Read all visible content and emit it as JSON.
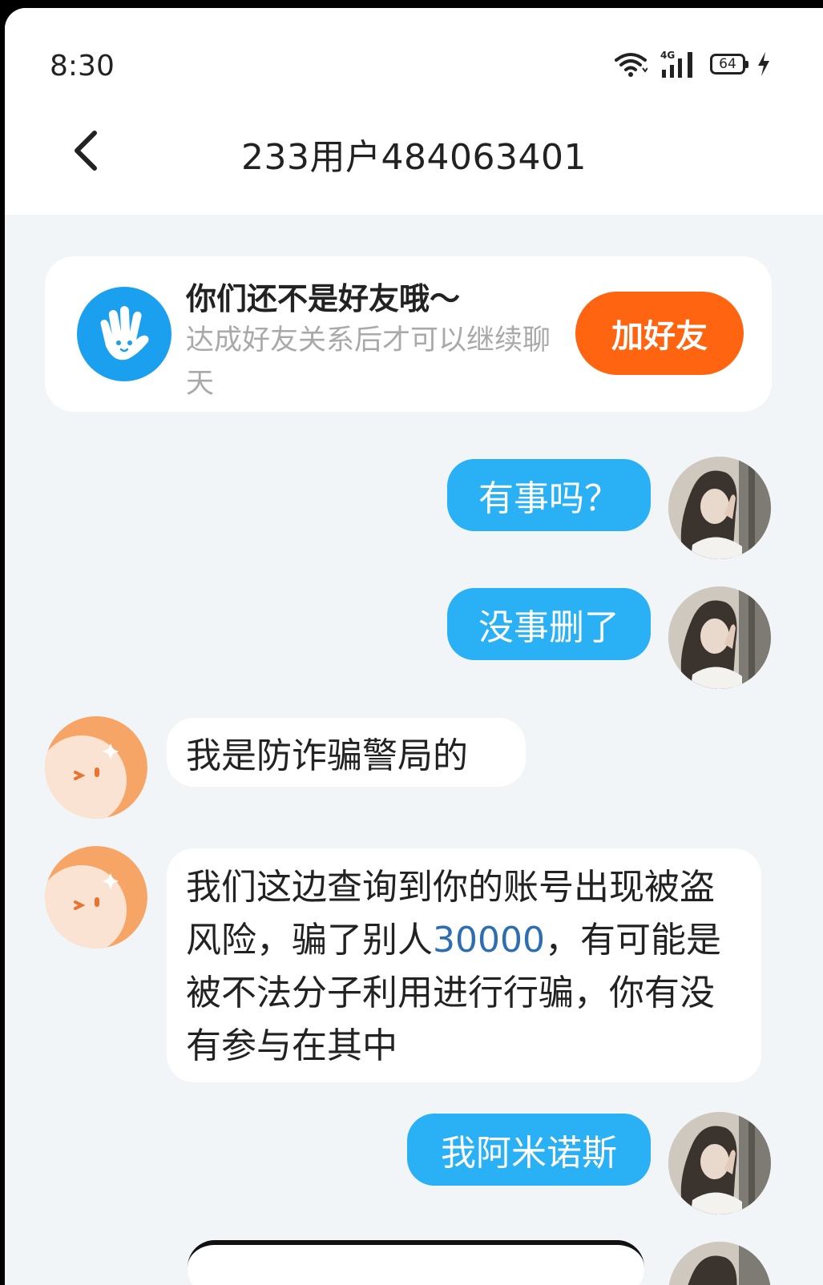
{
  "status_bar": {
    "time": "8:30",
    "network": "4G",
    "battery": "64"
  },
  "header": {
    "back_icon": "chevron-left-icon",
    "title": "233用户484063401"
  },
  "friend_banner": {
    "icon": "waving-hand-icon",
    "title": "你们还不是好友哦～",
    "subtitle": "达成好友关系后才可以继续聊天",
    "button_label": "加好友",
    "button_color": "#ff6411"
  },
  "messages": [
    {
      "side": "out",
      "text": "有事吗？"
    },
    {
      "side": "out",
      "text": "没事删了"
    },
    {
      "side": "in",
      "text": "我是防诈骗警局的"
    },
    {
      "side": "in",
      "text_before": "我们这边查询到你的账号出现被盗风险，骗了别人",
      "amount": "30000",
      "text_after": "，有可能是被不法分子利用进行行骗，你有没有参与在其中"
    },
    {
      "side": "out",
      "text": "我阿米诺斯"
    }
  ],
  "colors": {
    "outgoing_bubble": "#29b0f5",
    "incoming_bubble": "#ffffff",
    "background": "#f2f5f8",
    "amount_link": "#2d6db3"
  }
}
